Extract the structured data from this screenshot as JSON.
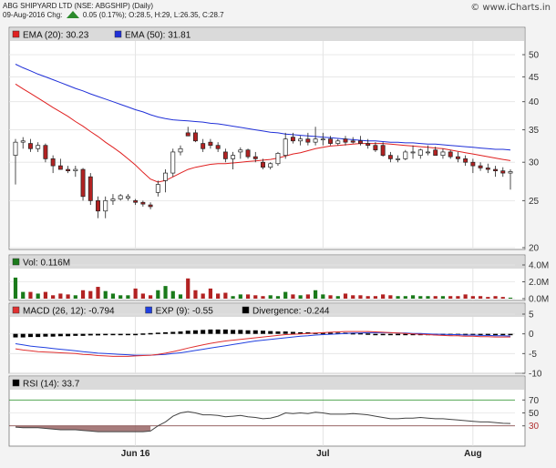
{
  "header": {
    "title": "ABG SHIPYARD LTD (NSE: ABGSHIP) (Daily)",
    "quote": "09-Aug-2016 Chg:",
    "change": "0.05 (0.17%); O:28.5, H:29, L:26.35, C:28.7",
    "brand": "© www.iCharts.in"
  },
  "colors": {
    "up": "#ffffff",
    "down": "#b22222",
    "ema20": "#e02020",
    "ema50": "#2030d8",
    "vol_up": "#1a7a1a",
    "vol_down": "#b22222",
    "macd": "#e03030",
    "exp": "#2040e0",
    "rsi": "#444444",
    "band": "#8a5050"
  },
  "chart_data": [
    {
      "type": "candlestick",
      "legend": [
        {
          "label": "EMA (20): 30.23",
          "color": "#e02020"
        },
        {
          "label": "EMA (50): 31.81",
          "color": "#2030d8"
        }
      ],
      "yscale": "log",
      "ylim": [
        20,
        55
      ],
      "yticks": [
        20,
        25,
        30,
        35,
        40,
        45,
        50
      ],
      "xticks": [
        {
          "label": "Jun 16",
          "index": 16
        },
        {
          "label": "Jul",
          "index": 41
        },
        {
          "label": "Aug",
          "index": 61
        }
      ],
      "candles": [
        [
          31.0,
          33.5,
          27.0,
          33.0
        ],
        [
          33.0,
          33.8,
          32.0,
          33.2
        ],
        [
          32.8,
          33.5,
          31.5,
          32.0
        ],
        [
          32.0,
          33.0,
          31.5,
          32.5
        ],
        [
          32.5,
          32.8,
          30.0,
          30.5
        ],
        [
          30.5,
          31.0,
          28.5,
          29.5
        ],
        [
          29.5,
          30.5,
          29.0,
          29.0
        ],
        [
          29.0,
          29.5,
          28.5,
          28.8
        ],
        [
          28.8,
          29.5,
          28.0,
          29.0
        ],
        [
          29.0,
          29.2,
          25.0,
          25.5
        ],
        [
          28.0,
          28.5,
          24.5,
          25.0
        ],
        [
          25.0,
          25.5,
          23.0,
          23.8
        ],
        [
          23.8,
          25.5,
          23.0,
          25.0
        ],
        [
          25.0,
          25.8,
          24.5,
          25.2
        ],
        [
          25.2,
          25.8,
          25.0,
          25.6
        ],
        [
          25.3,
          25.8,
          25.0,
          25.5
        ],
        [
          25.0,
          25.2,
          24.5,
          24.8
        ],
        [
          24.8,
          25.0,
          24.3,
          24.6
        ],
        [
          24.5,
          24.8,
          24.0,
          24.3
        ],
        [
          26.0,
          27.5,
          25.5,
          27.0
        ],
        [
          27.5,
          29.0,
          26.0,
          28.5
        ],
        [
          28.5,
          32.0,
          28.0,
          31.5
        ],
        [
          31.5,
          32.5,
          31.0,
          32.0
        ],
        [
          34.5,
          35.5,
          34.0,
          34.0
        ],
        [
          34.5,
          35.0,
          33.0,
          33.2
        ],
        [
          32.8,
          33.5,
          31.5,
          32.0
        ],
        [
          33.0,
          33.5,
          32.0,
          32.5
        ],
        [
          32.5,
          33.0,
          31.5,
          32.0
        ],
        [
          31.5,
          32.0,
          30.0,
          30.5
        ],
        [
          30.5,
          31.5,
          29.0,
          31.0
        ],
        [
          31.5,
          32.2,
          30.5,
          31.8
        ],
        [
          31.8,
          32.0,
          30.5,
          30.8
        ],
        [
          30.8,
          31.5,
          30.0,
          30.5
        ],
        [
          30.0,
          30.5,
          29.0,
          29.3
        ],
        [
          29.3,
          30.0,
          29.0,
          29.8
        ],
        [
          29.8,
          31.5,
          29.5,
          31.3
        ],
        [
          31.0,
          34.5,
          30.5,
          33.5
        ],
        [
          33.8,
          34.5,
          32.8,
          33.2
        ],
        [
          33.2,
          34.0,
          32.5,
          33.5
        ],
        [
          33.5,
          34.5,
          32.5,
          33.0
        ],
        [
          33.0,
          35.5,
          32.5,
          33.5
        ],
        [
          33.5,
          34.5,
          32.5,
          33.5
        ],
        [
          33.5,
          34.0,
          32.5,
          32.8
        ],
        [
          32.8,
          33.5,
          32.5,
          33.2
        ],
        [
          33.5,
          34.0,
          32.5,
          33.0
        ],
        [
          33.2,
          33.8,
          32.8,
          33.0
        ],
        [
          33.2,
          34.0,
          32.5,
          32.8
        ],
        [
          32.8,
          33.5,
          32.0,
          32.5
        ],
        [
          32.5,
          33.0,
          31.5,
          31.8
        ],
        [
          32.5,
          33.0,
          30.8,
          31.0
        ],
        [
          31.0,
          31.5,
          30.0,
          30.5
        ],
        [
          30.5,
          31.0,
          30.0,
          30.5
        ],
        [
          30.5,
          31.8,
          30.3,
          31.5
        ],
        [
          31.5,
          32.5,
          30.5,
          31.5
        ],
        [
          31.0,
          32.0,
          30.5,
          31.8
        ],
        [
          31.5,
          32.5,
          31.0,
          31.5
        ],
        [
          31.8,
          32.3,
          31.0,
          31.0
        ],
        [
          31.0,
          32.0,
          30.5,
          31.5
        ],
        [
          31.5,
          31.8,
          30.5,
          30.8
        ],
        [
          30.8,
          31.5,
          30.0,
          30.5
        ],
        [
          30.5,
          31.0,
          29.5,
          30.0
        ],
        [
          30.0,
          30.5,
          28.5,
          29.5
        ],
        [
          29.5,
          30.0,
          28.8,
          29.2
        ],
        [
          29.2,
          29.8,
          28.5,
          29.0
        ],
        [
          29.0,
          29.5,
          28.0,
          28.8
        ],
        [
          28.8,
          29.3,
          28.0,
          28.5
        ],
        [
          28.5,
          29.0,
          26.35,
          28.7
        ]
      ],
      "ema20": [
        43.5,
        42.5,
        41.6,
        40.7,
        39.8,
        38.9,
        38.1,
        37.3,
        36.4,
        35.6,
        34.7,
        33.9,
        33.0,
        32.2,
        31.4,
        30.5,
        29.6,
        28.6,
        27.7,
        27.3,
        27.5,
        28.0,
        28.5,
        29.0,
        29.3,
        29.5,
        29.7,
        29.8,
        29.8,
        29.9,
        30.0,
        30.1,
        30.2,
        30.3,
        30.4,
        30.6,
        30.9,
        31.2,
        31.4,
        31.7,
        32.0,
        32.2,
        32.4,
        32.5,
        32.6,
        32.7,
        32.8,
        32.8,
        32.8,
        32.8,
        32.7,
        32.6,
        32.5,
        32.4,
        32.3,
        32.2,
        32.1,
        32.0,
        31.8,
        31.6,
        31.4,
        31.2,
        31.0,
        30.8,
        30.6,
        30.4,
        30.23
      ],
      "ema50": [
        47.8,
        47.0,
        46.3,
        45.6,
        45.0,
        44.4,
        43.8,
        43.2,
        42.6,
        42.1,
        41.5,
        41.0,
        40.5,
        40.0,
        39.5,
        39.0,
        38.5,
        38.1,
        37.6,
        37.2,
        36.9,
        36.7,
        36.6,
        36.5,
        36.4,
        36.3,
        36.1,
        36.0,
        35.8,
        35.6,
        35.4,
        35.2,
        35.0,
        34.8,
        34.6,
        34.5,
        34.3,
        34.2,
        34.1,
        34.0,
        33.9,
        33.8,
        33.7,
        33.6,
        33.5,
        33.4,
        33.3,
        33.2,
        33.2,
        33.1,
        33.0,
        33.0,
        32.9,
        32.9,
        32.8,
        32.7,
        32.7,
        32.6,
        32.5,
        32.4,
        32.3,
        32.2,
        32.1,
        32.0,
        31.9,
        31.9,
        31.81
      ]
    },
    {
      "type": "bar",
      "legend": [
        {
          "label": "Vol: 0.116M",
          "color": "#1a7a1a"
        }
      ],
      "ylim": [
        0,
        4.0
      ],
      "yticks": [
        {
          "v": 0,
          "label": "0.0M"
        },
        {
          "v": 2,
          "label": "2.0M"
        },
        {
          "v": 4,
          "label": "4.0M"
        }
      ],
      "values": [
        2.5,
        0.8,
        0.8,
        0.6,
        0.8,
        0.4,
        0.6,
        0.5,
        0.4,
        1.0,
        0.9,
        1.4,
        0.9,
        0.6,
        0.4,
        0.4,
        1.2,
        0.6,
        0.4,
        1.0,
        1.5,
        0.9,
        0.5,
        2.4,
        1.0,
        0.6,
        1.2,
        0.6,
        0.7,
        0.3,
        0.5,
        0.5,
        0.4,
        0.3,
        0.4,
        0.3,
        0.8,
        0.5,
        0.4,
        0.5,
        1.0,
        0.5,
        0.4,
        0.3,
        0.6,
        0.4,
        0.4,
        0.3,
        0.3,
        0.5,
        0.4,
        0.3,
        0.3,
        0.4,
        0.3,
        0.3,
        0.3,
        0.3,
        0.3,
        0.3,
        0.5,
        0.3,
        0.3,
        0.2,
        0.3,
        0.2,
        0.116
      ]
    },
    {
      "type": "line",
      "legend": [
        {
          "label": "MACD (26, 12): -0.794",
          "color": "#e03030"
        },
        {
          "label": "EXP (9): -0.55",
          "color": "#2040e0"
        },
        {
          "label": "Divergence: -0.244",
          "color": "#000000"
        }
      ],
      "ylim": [
        -10,
        5
      ],
      "yticks": [
        5,
        0,
        -5,
        -10
      ],
      "macd": [
        -3.8,
        -4.1,
        -4.3,
        -4.5,
        -4.6,
        -4.7,
        -4.8,
        -4.9,
        -5.0,
        -5.2,
        -5.3,
        -5.5,
        -5.6,
        -5.7,
        -5.7,
        -5.7,
        -5.6,
        -5.5,
        -5.4,
        -5.2,
        -4.9,
        -4.5,
        -4.1,
        -3.6,
        -3.2,
        -2.8,
        -2.4,
        -2.1,
        -1.8,
        -1.6,
        -1.4,
        -1.2,
        -1.0,
        -0.8,
        -0.6,
        -0.4,
        -0.2,
        -0.1,
        0.0,
        0.1,
        0.2,
        0.3,
        0.4,
        0.5,
        0.6,
        0.6,
        0.6,
        0.6,
        0.5,
        0.4,
        0.3,
        0.2,
        0.1,
        0.0,
        -0.1,
        -0.2,
        -0.3,
        -0.4,
        -0.5,
        -0.5,
        -0.6,
        -0.6,
        -0.7,
        -0.7,
        -0.8,
        -0.8,
        -0.794
      ],
      "exp": [
        -2.5,
        -2.8,
        -3.1,
        -3.3,
        -3.5,
        -3.7,
        -3.9,
        -4.1,
        -4.3,
        -4.5,
        -4.7,
        -4.9,
        -5.0,
        -5.1,
        -5.2,
        -5.3,
        -5.4,
        -5.4,
        -5.4,
        -5.3,
        -5.2,
        -5.0,
        -4.8,
        -4.5,
        -4.2,
        -3.9,
        -3.6,
        -3.3,
        -3.0,
        -2.7,
        -2.4,
        -2.1,
        -1.8,
        -1.6,
        -1.4,
        -1.2,
        -1.0,
        -0.8,
        -0.6,
        -0.5,
        -0.3,
        -0.2,
        -0.1,
        0.0,
        0.1,
        0.2,
        0.2,
        0.3,
        0.3,
        0.3,
        0.3,
        0.2,
        0.2,
        0.1,
        0.1,
        0.0,
        -0.1,
        -0.1,
        -0.2,
        -0.2,
        -0.3,
        -0.3,
        -0.4,
        -0.4,
        -0.5,
        -0.5,
        -0.55
      ],
      "divergence": [
        -0.9,
        -0.9,
        -0.8,
        -0.8,
        -0.7,
        -0.7,
        -0.6,
        -0.6,
        -0.5,
        -0.5,
        -0.4,
        -0.4,
        -0.3,
        -0.3,
        -0.2,
        -0.1,
        0.0,
        0.1,
        0.2,
        0.3,
        0.4,
        0.5,
        0.6,
        0.8,
        0.9,
        1.0,
        1.1,
        1.1,
        1.1,
        1.0,
        1.0,
        0.9,
        0.9,
        0.8,
        0.7,
        0.6,
        0.6,
        0.5,
        0.4,
        0.4,
        0.3,
        0.3,
        0.3,
        0.3,
        0.3,
        0.2,
        0.2,
        0.1,
        0.0,
        -0.1,
        -0.2,
        -0.2,
        -0.2,
        -0.2,
        -0.2,
        -0.2,
        -0.2,
        -0.2,
        -0.2,
        -0.2,
        -0.2,
        -0.2,
        -0.2,
        -0.2,
        -0.2,
        -0.2,
        -0.244
      ]
    },
    {
      "type": "line",
      "legend": [
        {
          "label": "RSI (14): 33.7",
          "color": "#000000"
        }
      ],
      "ylim": [
        0,
        100
      ],
      "yticks": [
        30,
        50,
        70
      ],
      "guides": [
        30,
        70
      ],
      "values": [
        28,
        27,
        27,
        27,
        26,
        25,
        24,
        24,
        24,
        23,
        22,
        21,
        21,
        21,
        21,
        21,
        21,
        21,
        22,
        30,
        36,
        45,
        50,
        52,
        50,
        47,
        47,
        46,
        44,
        45,
        46,
        44,
        43,
        41,
        42,
        45,
        50,
        49,
        50,
        49,
        51,
        50,
        48,
        48,
        48,
        49,
        48,
        47,
        45,
        43,
        41,
        41,
        42,
        42,
        43,
        42,
        41,
        41,
        40,
        39,
        38,
        37,
        36,
        36,
        35,
        34,
        33.7
      ]
    }
  ]
}
